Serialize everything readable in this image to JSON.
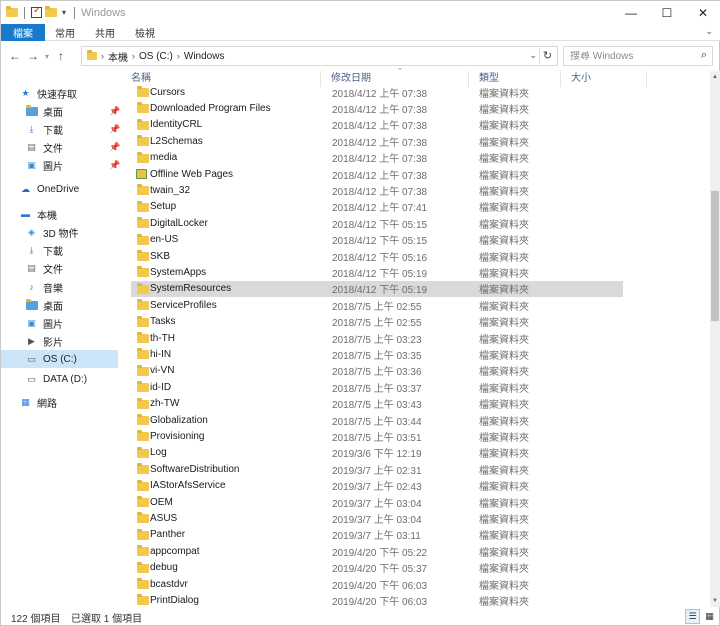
{
  "window": {
    "title": "Windows",
    "minimize": "—",
    "maximize": "☐",
    "close": "✕"
  },
  "ribbon": {
    "tabs": [
      "檔案",
      "常用",
      "共用",
      "檢視"
    ],
    "expand": "⌄"
  },
  "address": {
    "crumbs": [
      "本機",
      "OS (C:)",
      "Windows"
    ],
    "search_placeholder": "搜尋 Windows"
  },
  "nav": {
    "items": [
      {
        "label": "快速存取",
        "icon": "star-icon",
        "pinned": false
      },
      {
        "label": "桌面",
        "icon": "desktop-folder-icon",
        "pinned": true
      },
      {
        "label": "下載",
        "icon": "download-folder-icon",
        "pinned": true
      },
      {
        "label": "文件",
        "icon": "documents-folder-icon",
        "pinned": true
      },
      {
        "label": "圖片",
        "icon": "pictures-folder-icon",
        "pinned": true
      },
      {
        "label": "OneDrive",
        "icon": "cloud-icon",
        "pinned": false
      },
      {
        "label": "本機",
        "icon": "computer-icon",
        "pinned": false
      },
      {
        "label": "3D 物件",
        "icon": "3d-objects-icon",
        "pinned": false
      },
      {
        "label": "下載",
        "icon": "download-folder-icon",
        "pinned": false
      },
      {
        "label": "文件",
        "icon": "documents-folder-icon",
        "pinned": false
      },
      {
        "label": "音樂",
        "icon": "music-icon",
        "pinned": false
      },
      {
        "label": "桌面",
        "icon": "desktop-folder-icon",
        "pinned": false
      },
      {
        "label": "圖片",
        "icon": "pictures-folder-icon",
        "pinned": false
      },
      {
        "label": "影片",
        "icon": "videos-folder-icon",
        "pinned": false
      },
      {
        "label": "OS (C:)",
        "icon": "os-drive-icon",
        "pinned": false,
        "selected": true
      },
      {
        "label": "DATA (D:)",
        "icon": "drive-icon",
        "pinned": false
      },
      {
        "label": "網路",
        "icon": "network-icon",
        "pinned": false
      }
    ]
  },
  "columns": {
    "name": "名稱",
    "modified": "修改日期",
    "type": "類型",
    "size": "大小"
  },
  "files": [
    {
      "name": "Cursors",
      "modified": "2018/4/12 上午 07:38",
      "type": "檔案資料夾"
    },
    {
      "name": "Downloaded Program Files",
      "modified": "2018/4/12 上午 07:38",
      "type": "檔案資料夾"
    },
    {
      "name": "IdentityCRL",
      "modified": "2018/4/12 上午 07:38",
      "type": "檔案資料夾"
    },
    {
      "name": "L2Schemas",
      "modified": "2018/4/12 上午 07:38",
      "type": "檔案資料夾"
    },
    {
      "name": "media",
      "modified": "2018/4/12 上午 07:38",
      "type": "檔案資料夾"
    },
    {
      "name": "Offline Web Pages",
      "modified": "2018/4/12 上午 07:38",
      "type": "檔案資料夾",
      "special": true
    },
    {
      "name": "twain_32",
      "modified": "2018/4/12 上午 07:38",
      "type": "檔案資料夾"
    },
    {
      "name": "Setup",
      "modified": "2018/4/12 上午 07:41",
      "type": "檔案資料夾"
    },
    {
      "name": "DigitalLocker",
      "modified": "2018/4/12 下午 05:15",
      "type": "檔案資料夾"
    },
    {
      "name": "en-US",
      "modified": "2018/4/12 下午 05:15",
      "type": "檔案資料夾"
    },
    {
      "name": "SKB",
      "modified": "2018/4/12 下午 05:16",
      "type": "檔案資料夾"
    },
    {
      "name": "SystemApps",
      "modified": "2018/4/12 下午 05:19",
      "type": "檔案資料夾"
    },
    {
      "name": "SystemResources",
      "modified": "2018/4/12 下午 05:19",
      "type": "檔案資料夾",
      "selected": true
    },
    {
      "name": "ServiceProfiles",
      "modified": "2018/7/5 上午 02:55",
      "type": "檔案資料夾"
    },
    {
      "name": "Tasks",
      "modified": "2018/7/5 上午 02:55",
      "type": "檔案資料夾"
    },
    {
      "name": "th-TH",
      "modified": "2018/7/5 上午 03:23",
      "type": "檔案資料夾"
    },
    {
      "name": "hi-IN",
      "modified": "2018/7/5 上午 03:35",
      "type": "檔案資料夾"
    },
    {
      "name": "vi-VN",
      "modified": "2018/7/5 上午 03:36",
      "type": "檔案資料夾"
    },
    {
      "name": "id-ID",
      "modified": "2018/7/5 上午 03:37",
      "type": "檔案資料夾"
    },
    {
      "name": "zh-TW",
      "modified": "2018/7/5 上午 03:43",
      "type": "檔案資料夾"
    },
    {
      "name": "Globalization",
      "modified": "2018/7/5 上午 03:44",
      "type": "檔案資料夾"
    },
    {
      "name": "Provisioning",
      "modified": "2018/7/5 上午 03:51",
      "type": "檔案資料夾"
    },
    {
      "name": "Log",
      "modified": "2019/3/6 下午 12:19",
      "type": "檔案資料夾"
    },
    {
      "name": "SoftwareDistribution",
      "modified": "2019/3/7 上午 02:31",
      "type": "檔案資料夾"
    },
    {
      "name": "IAStorAfsService",
      "modified": "2019/3/7 上午 02:43",
      "type": "檔案資料夾"
    },
    {
      "name": "OEM",
      "modified": "2019/3/7 上午 03:04",
      "type": "檔案資料夾"
    },
    {
      "name": "ASUS",
      "modified": "2019/3/7 上午 03:04",
      "type": "檔案資料夾"
    },
    {
      "name": "Panther",
      "modified": "2019/3/7 上午 03:11",
      "type": "檔案資料夾"
    },
    {
      "name": "appcompat",
      "modified": "2019/4/20 下午 05:22",
      "type": "檔案資料夾"
    },
    {
      "name": "debug",
      "modified": "2019/4/20 下午 05:37",
      "type": "檔案資料夾"
    },
    {
      "name": "bcastdvr",
      "modified": "2019/4/20 下午 06:03",
      "type": "檔案資料夾"
    },
    {
      "name": "PrintDialog",
      "modified": "2019/4/20 下午 06:03",
      "type": "檔案資料夾"
    }
  ],
  "status": {
    "count": "122 個項目",
    "selected": "已選取 1 個項目"
  },
  "colors": {
    "accent": "#1979ca",
    "folder": "#f2c94c",
    "selection": "#d9d9d9",
    "nav_selection": "#cce4f7"
  }
}
